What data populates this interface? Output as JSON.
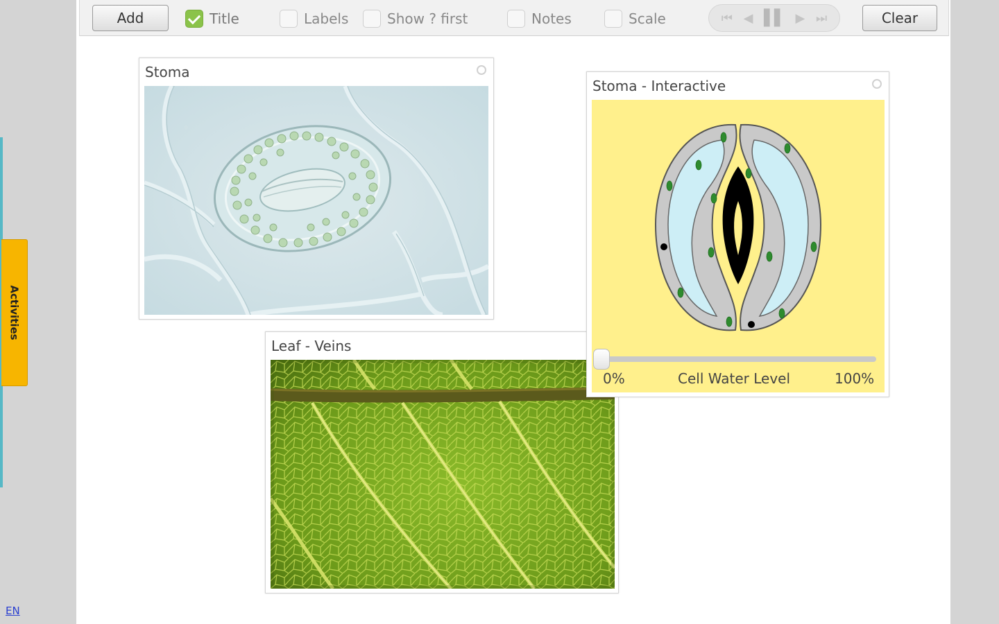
{
  "sidebar": {
    "activities_label": "Activities",
    "language_link": "EN"
  },
  "toolbar": {
    "add_label": "Add",
    "clear_label": "Clear",
    "checkboxes": [
      {
        "label": "Title",
        "checked": true
      },
      {
        "label": "Labels",
        "checked": false
      },
      {
        "label": "Show ? first",
        "checked": false
      },
      {
        "label": "Notes",
        "checked": false
      },
      {
        "label": "Scale",
        "checked": false
      }
    ],
    "media_controls": [
      "skip-to-start-icon",
      "step-back-icon",
      "pause-icon",
      "step-forward-icon",
      "skip-to-end-icon"
    ]
  },
  "panels": {
    "stoma": {
      "title": "Stoma"
    },
    "stoma_interactive": {
      "title": "Stoma - Interactive",
      "slider_min_label": "0%",
      "slider_caption": "Cell Water Level",
      "slider_max_label": "100%",
      "water_level": 0
    },
    "leaf_veins": {
      "title": "Leaf - Veins"
    }
  },
  "colors": {
    "activities_tab": "#f7b500",
    "interactive_bg": "#fff08c",
    "guard_cell_fill": "#c8eef6",
    "check_green": "#8bc34a"
  }
}
